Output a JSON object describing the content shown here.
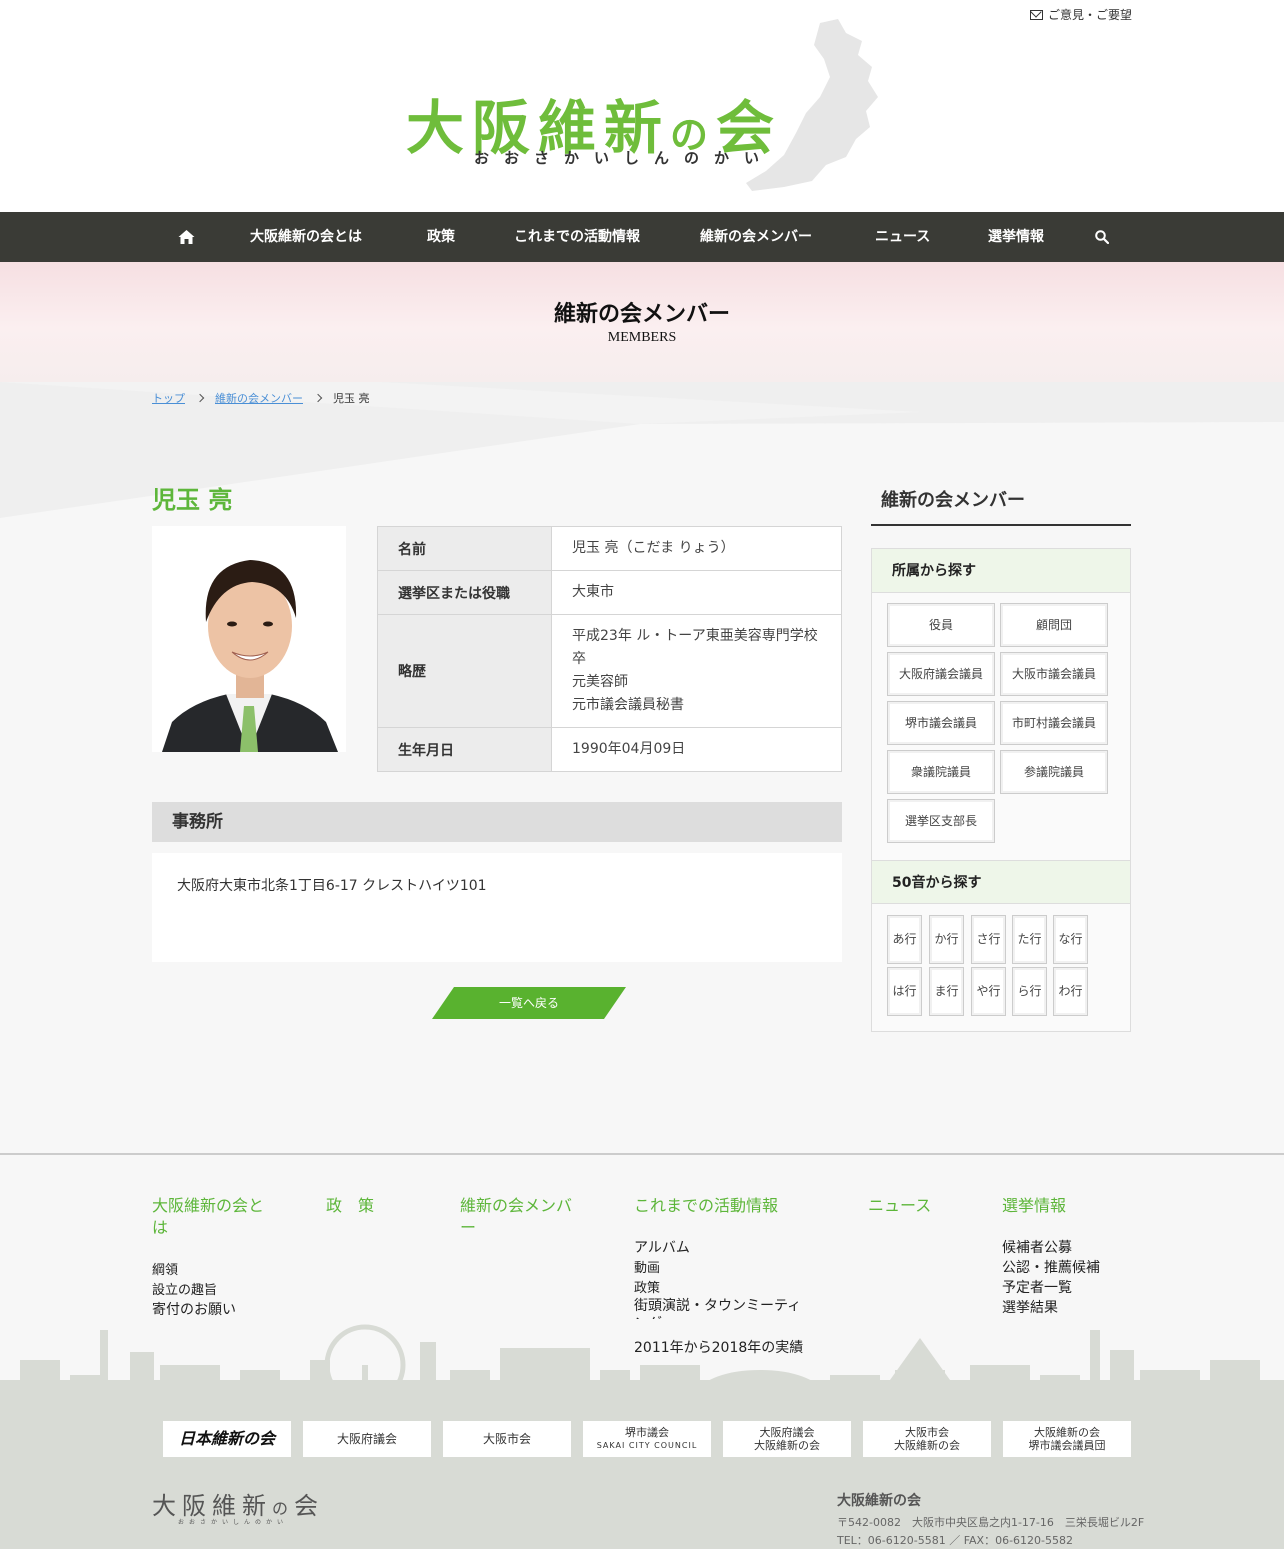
{
  "header": {
    "feedback_label": "ご意見・ご要望",
    "logo_main_a": "大阪維新",
    "logo_main_no": "の",
    "logo_main_b": "会",
    "logo_sub": "おおさかいしんのかい"
  },
  "nav": {
    "items": [
      "大阪維新の会とは",
      "政策",
      "これまでの活動情報",
      "維新の会メンバー",
      "ニュース",
      "選挙情報"
    ]
  },
  "hero": {
    "title": "維新の会メンバー",
    "subtitle": "MEMBERS"
  },
  "breadcrumb": [
    "トップ",
    "維新の会メンバー",
    "児玉 亮"
  ],
  "member": {
    "name": "児玉 亮",
    "rows": [
      {
        "label": "名前",
        "value": [
          "児玉 亮（こだま りょう）"
        ]
      },
      {
        "label": "選挙区または役職",
        "value": [
          "大東市"
        ]
      },
      {
        "label": "略歴",
        "value": [
          "平成23年 ル・トーア東亜美容専門学校卒",
          "元美容師",
          "元市議会議員秘書"
        ]
      },
      {
        "label": "生年月日",
        "value": [
          "1990年04月09日"
        ]
      }
    ]
  },
  "office": {
    "heading": "事務所",
    "address": "大阪府大東市北条1丁目6-17 クレストハイツ101"
  },
  "back_button": "一覧へ戻る",
  "sidebar": {
    "title": "維新の会メンバー",
    "affiliation_heading": "所属から探す",
    "affiliations": [
      "役員",
      "顧問団",
      "大阪府議会議員",
      "大阪市議会議員",
      "堺市議会議員",
      "市町村議会議員",
      "衆議院議員",
      "参議院議員",
      "選挙区支部長"
    ],
    "kana_heading": "50音から探す",
    "kana": [
      "あ行",
      "か行",
      "さ行",
      "た行",
      "な行",
      "は行",
      "ま行",
      "や行",
      "ら行",
      "わ行"
    ]
  },
  "footer": {
    "columns": [
      {
        "title": "大阪維新の会とは",
        "links": [
          "綱領",
          "設立の趣旨",
          "寄付のお願い"
        ]
      },
      {
        "title": "政　策",
        "links": []
      },
      {
        "title": "維新の会メンバー",
        "links": []
      },
      {
        "title": "これまでの活動情報",
        "links": [
          "アルバム",
          "動画",
          "政策",
          "街頭演説・タウンミーティング",
          "2011年から2018年の実績"
        ]
      },
      {
        "title": "ニュース",
        "links": []
      },
      {
        "title": "選挙情報",
        "links": [
          "候補者公募",
          "公認・推薦候補",
          "予定者一覧",
          "選挙結果"
        ]
      }
    ],
    "banners": [
      {
        "lines": [
          "日本維新の会"
        ]
      },
      {
        "lines": [
          "大阪府議会"
        ]
      },
      {
        "lines": [
          "大阪市会"
        ]
      },
      {
        "lines": [
          "堺市議会",
          "SAKAI CITY COUNCIL"
        ]
      },
      {
        "lines": [
          "大阪府議会",
          "大阪維新の会"
        ]
      },
      {
        "lines": [
          "大阪市会",
          "大阪維新の会"
        ]
      },
      {
        "lines": [
          "大阪維新の会",
          "堺市議会議員団"
        ]
      }
    ],
    "org_name": "大阪維新の会",
    "address": "〒542-0082　大阪市中央区島之内1-17-16　三栄長堀ビル2F",
    "tel_fax": "TEL：06-6120-5581 ／ FAX：06-6120-5582"
  },
  "colors": {
    "accent": "#5db63a",
    "nav_bg": "#3a3b36"
  }
}
